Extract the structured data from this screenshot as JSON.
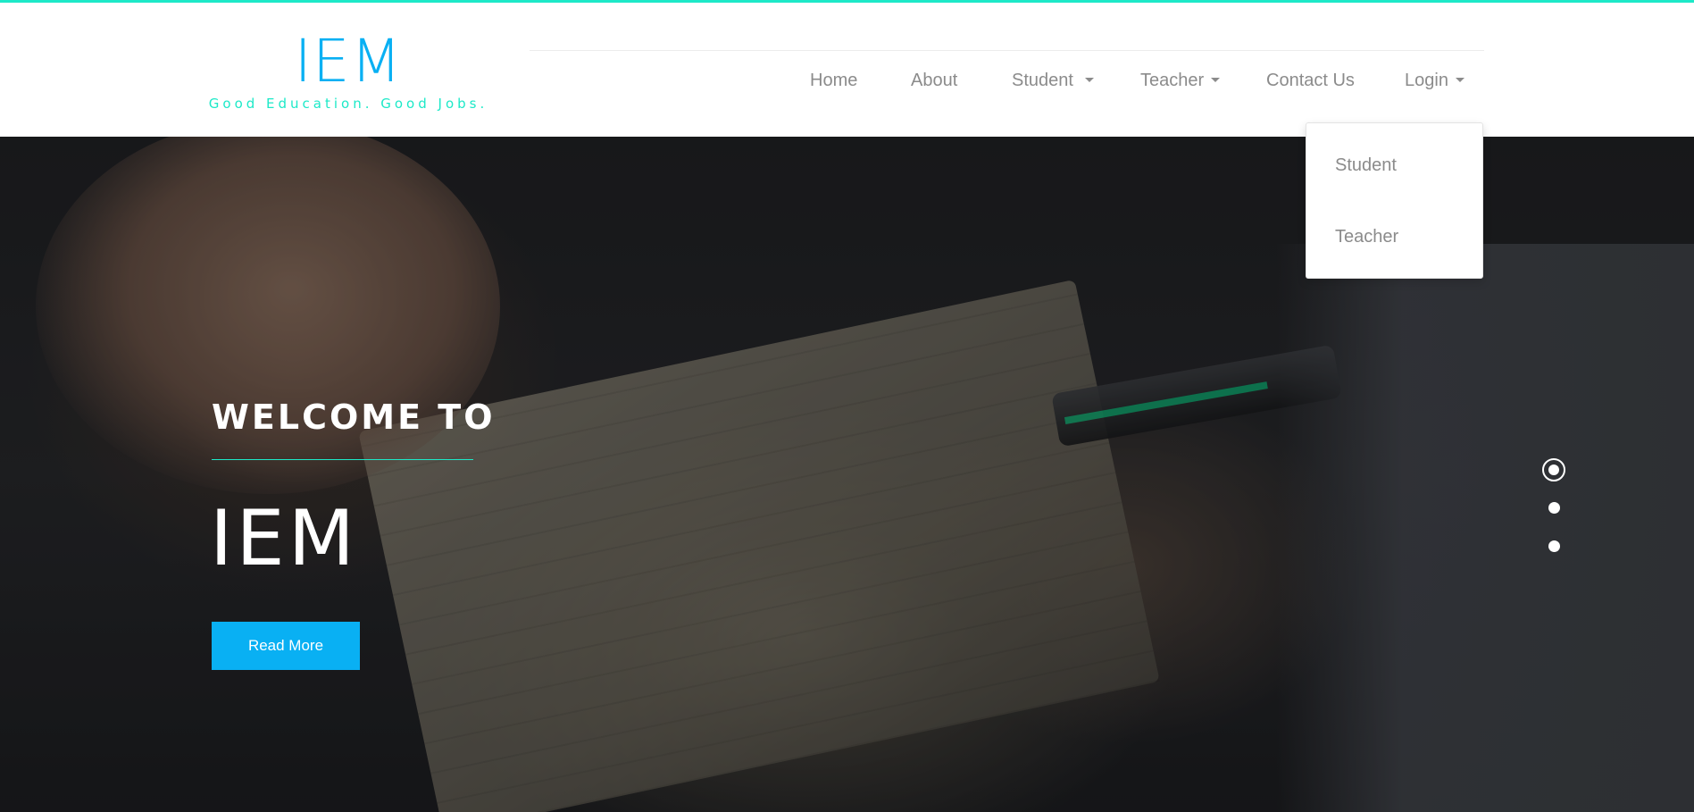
{
  "brand": {
    "title": "IEM",
    "tagline": "Good Education. Good Jobs.",
    "colors": {
      "primary": "#09b0f3",
      "accent": "#1de9c8"
    }
  },
  "nav": {
    "home": "Home",
    "about": "About",
    "student": "Student",
    "teacher": "Teacher",
    "contact": "Contact Us",
    "login": "Login"
  },
  "login_menu": {
    "items": [
      "Student",
      "Teacher"
    ]
  },
  "hero": {
    "welcome": "WELCOME TO",
    "title": "IEM",
    "button_label": "Read More",
    "slides": {
      "count": 3,
      "active_index": 0
    }
  }
}
